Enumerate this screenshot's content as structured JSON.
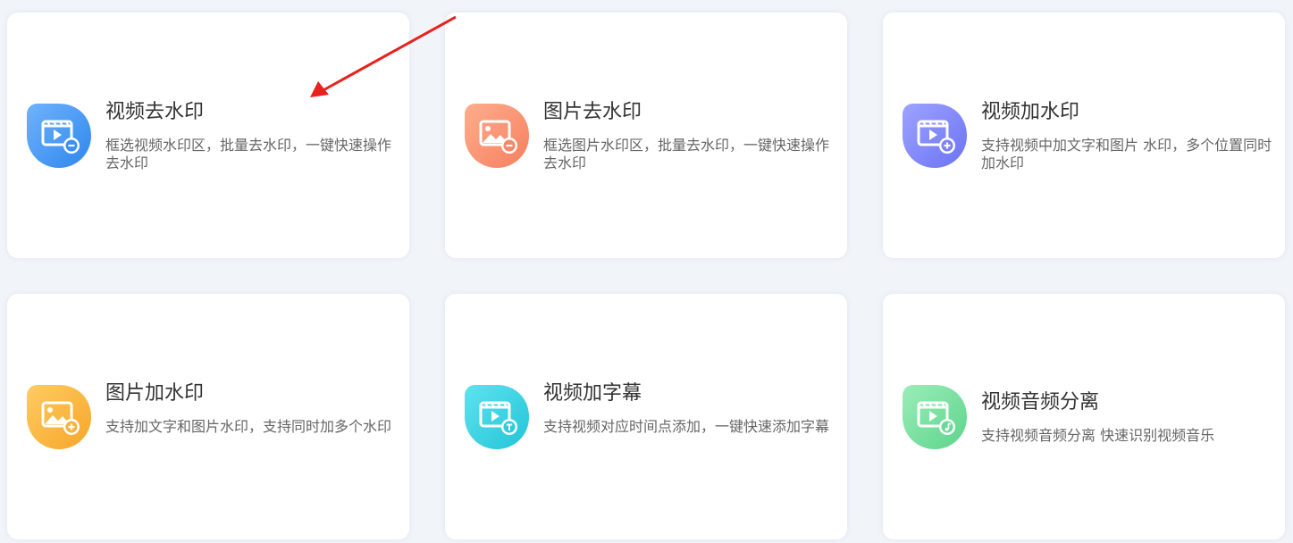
{
  "cards": [
    {
      "title": "视频去水印",
      "description": "框选视频水印区，批量去水印，一键快速操作去水印",
      "icon": "video-remove-watermark-icon",
      "color_from": "#6fb3fb",
      "color_to": "#2e86ee"
    },
    {
      "title": "图片去水印",
      "description": "框选图片水印区，批量去水印，一键快速操作去水印",
      "icon": "image-remove-watermark-icon",
      "color_from": "#ffad8d",
      "color_to": "#f57f5f"
    },
    {
      "title": "视频加水印",
      "description": "支持视频中加文字和图片 水印，多个位置同时加水印",
      "icon": "video-add-watermark-icon",
      "color_from": "#9da3ff",
      "color_to": "#6b72f4"
    },
    {
      "title": "图片加水印",
      "description": "支持加文字和图片水印，支持同时加多个水印",
      "icon": "image-add-watermark-icon",
      "color_from": "#ffcb62",
      "color_to": "#f6a628"
    },
    {
      "title": "视频加字幕",
      "description": "支持视频对应时间点添加，一键快速添加字幕",
      "icon": "video-add-subtitle-icon",
      "color_from": "#5ee3ee",
      "color_to": "#22c4d8"
    },
    {
      "title": "视频音频分离",
      "description": "支持视频音频分离 快速识别视频音乐",
      "icon": "video-audio-separate-icon",
      "color_from": "#9bedb9",
      "color_to": "#5cd48a"
    }
  ],
  "annotation": {
    "arrow_color": "#e8211d"
  }
}
